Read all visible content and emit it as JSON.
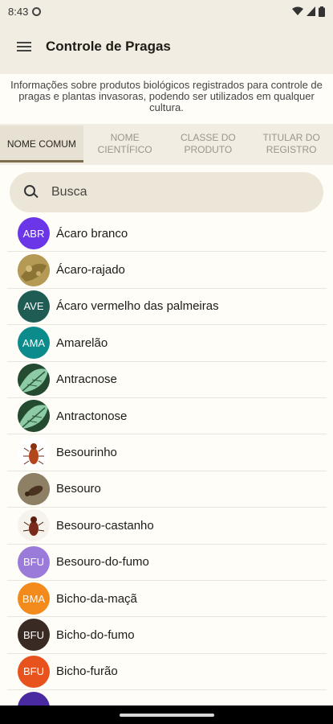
{
  "status_bar": {
    "time": "8:43"
  },
  "app_bar": {
    "title": "Controle de Pragas"
  },
  "info_text": "Informações sobre produtos biológicos registrados para controle de pragas e plantas invasoras, podendo ser utilizados em qualquer cultura.",
  "tabs": [
    {
      "label": "NOME COMUM",
      "active": true
    },
    {
      "label": "NOME CIENTÍFICO",
      "active": false
    },
    {
      "label": "CLASSE DO PRODUTO",
      "active": false
    },
    {
      "label": "TITULAR DO REGISTRO",
      "active": false
    }
  ],
  "search": {
    "placeholder": "Busca"
  },
  "items": [
    {
      "label": "Ácaro branco",
      "initials": "ABR",
      "color": "#6b35e8",
      "kind": "initials"
    },
    {
      "label": "Ácaro-rajado",
      "initials": "",
      "color": "#a08a4a",
      "kind": "photo-leaf"
    },
    {
      "label": "Ácaro vermelho das palmeiras",
      "initials": "AVE",
      "color": "#1f5c54",
      "kind": "initials"
    },
    {
      "label": "Amarelão",
      "initials": "AMA",
      "color": "#0b8b8b",
      "kind": "initials"
    },
    {
      "label": "Antracnose",
      "initials": "",
      "color": "#2d5a3a",
      "kind": "photo-leaf-green"
    },
    {
      "label": "Antractonose",
      "initials": "",
      "color": "#2d5a3a",
      "kind": "photo-leaf-green"
    },
    {
      "label": "Besourinho",
      "initials": "",
      "color": "#ffffff",
      "kind": "photo-beetle"
    },
    {
      "label": "Besouro",
      "initials": "",
      "color": "#7a6a4a",
      "kind": "photo-brown"
    },
    {
      "label": "Besouro-castanho",
      "initials": "",
      "color": "#ffffff",
      "kind": "photo-beetle2"
    },
    {
      "label": "Besouro-do-fumo",
      "initials": "BFU",
      "color": "#9a7bd9",
      "kind": "initials"
    },
    {
      "label": "Bicho-da-maçã",
      "initials": "BMA",
      "color": "#f28a1c",
      "kind": "initials"
    },
    {
      "label": "Bicho-do-fumo",
      "initials": "BFU",
      "color": "#3a2a24",
      "kind": "initials"
    },
    {
      "label": "Bicho-furão",
      "initials": "BFU",
      "color": "#e8521c",
      "kind": "initials"
    },
    {
      "label": "",
      "initials": "",
      "color": "#4a2aa0",
      "kind": "initials"
    }
  ]
}
